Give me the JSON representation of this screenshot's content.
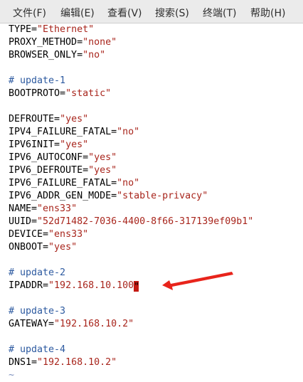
{
  "menubar": {
    "items": [
      "文件(F)",
      "编辑(E)",
      "查看(V)",
      "搜索(S)",
      "终端(T)",
      "帮助(H)"
    ]
  },
  "editor": {
    "lines": [
      {
        "type": "kv",
        "key": "TYPE=",
        "value": "\"Ethernet\""
      },
      {
        "type": "kv",
        "key": "PROXY_METHOD=",
        "value": "\"none\""
      },
      {
        "type": "kv",
        "key": "BROWSER_ONLY=",
        "value": "\"no\""
      },
      {
        "type": "blank"
      },
      {
        "type": "comment",
        "text": "# update-1"
      },
      {
        "type": "kv",
        "key": "BOOTPROTO=",
        "value": "\"static\""
      },
      {
        "type": "blank"
      },
      {
        "type": "kv",
        "key": "DEFROUTE=",
        "value": "\"yes\""
      },
      {
        "type": "kv",
        "key": "IPV4_FAILURE_FATAL=",
        "value": "\"no\""
      },
      {
        "type": "kv",
        "key": "IPV6INIT=",
        "value": "\"yes\""
      },
      {
        "type": "kv",
        "key": "IPV6_AUTOCONF=",
        "value": "\"yes\""
      },
      {
        "type": "kv",
        "key": "IPV6_DEFROUTE=",
        "value": "\"yes\""
      },
      {
        "type": "kv",
        "key": "IPV6_FAILURE_FATAL=",
        "value": "\"no\""
      },
      {
        "type": "kv",
        "key": "IPV6_ADDR_GEN_MODE=",
        "value": "\"stable-privacy\""
      },
      {
        "type": "kv",
        "key": "NAME=",
        "value": "\"ens33\""
      },
      {
        "type": "kv",
        "key": "UUID=",
        "value": "\"52d71482-7036-4400-8f66-317139ef09b1\""
      },
      {
        "type": "kv",
        "key": "DEVICE=",
        "value": "\"ens33\""
      },
      {
        "type": "kv",
        "key": "ONBOOT=",
        "value": "\"yes\""
      },
      {
        "type": "blank"
      },
      {
        "type": "comment",
        "text": "# update-2"
      },
      {
        "type": "kv",
        "key": "IPADDR=",
        "value": "\"192.168.10.100",
        "cursor": "\""
      },
      {
        "type": "blank"
      },
      {
        "type": "comment",
        "text": "# update-3"
      },
      {
        "type": "kv",
        "key": "GATEWAY=",
        "value": "\"192.168.10.2\""
      },
      {
        "type": "blank"
      },
      {
        "type": "comment",
        "text": "# update-4"
      },
      {
        "type": "kv",
        "key": "DNS1=",
        "value": "\"192.168.10.2\""
      },
      {
        "type": "tilde",
        "text": "~"
      }
    ]
  },
  "colors": {
    "comment": "#2d5aa0",
    "string": "#a8251c",
    "cursor": "#c41a12",
    "arrow": "#e8241b",
    "menubar_bg": "#ebebeb"
  },
  "annotation": {
    "icon": "red-arrow-icon"
  }
}
